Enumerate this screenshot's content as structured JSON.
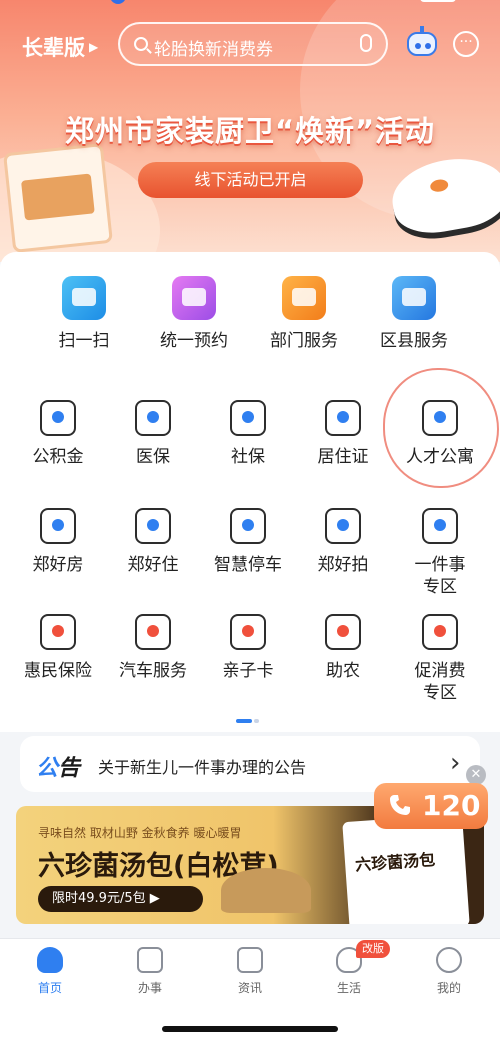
{
  "header": {
    "elder_mode_label": "长辈版",
    "search_placeholder": "轮胎换新消费券"
  },
  "banner": {
    "title": "郑州市家装厨卫“焕新”活动",
    "button_label": "线下活动已开启"
  },
  "primary_services": [
    {
      "label": "扫一扫"
    },
    {
      "label": "统一预约"
    },
    {
      "label": "部门服务"
    },
    {
      "label": "区县服务"
    }
  ],
  "services": [
    {
      "label": "公积金"
    },
    {
      "label": "医保"
    },
    {
      "label": "社保"
    },
    {
      "label": "居住证"
    },
    {
      "label": "人才公寓"
    },
    {
      "label": "郑好房"
    },
    {
      "label": "郑好住"
    },
    {
      "label": "智慧停车"
    },
    {
      "label": "郑好拍"
    },
    {
      "label": "一件事\n专区"
    },
    {
      "label": "惠民保险"
    },
    {
      "label": "汽车服务"
    },
    {
      "label": "亲子卡"
    },
    {
      "label": "助农"
    },
    {
      "label": "促消费\n专区"
    }
  ],
  "notice": {
    "tag_part1": "公",
    "tag_part2": "告",
    "text": "关于新生儿一件事办理的公告"
  },
  "ad": {
    "tagline": "寻味自然 取材山野 金秋食养 暖心暖胃",
    "title": "六珍菌汤包(白松茸)",
    "price": "限时49.9元/5包 ▶",
    "pack_text": "六珍菌汤包"
  },
  "emergency": {
    "number": "120"
  },
  "tabbar": {
    "items": [
      {
        "label": "首页"
      },
      {
        "label": "办事"
      },
      {
        "label": "资讯"
      },
      {
        "label": "生活"
      },
      {
        "label": "我的"
      }
    ],
    "badge": "改版"
  }
}
